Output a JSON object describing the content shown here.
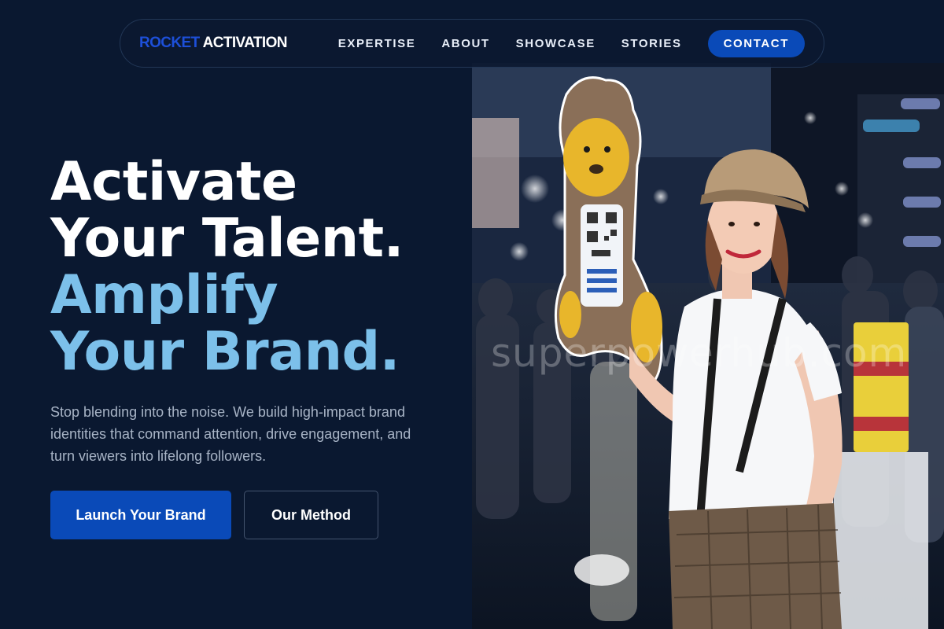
{
  "brand": {
    "part1": "ROCKET",
    "part2": "ACTIVATION"
  },
  "nav": {
    "links": [
      "EXPERTISE",
      "ABOUT",
      "SHOWCASE",
      "STORIES"
    ],
    "cta": "CONTACT"
  },
  "hero": {
    "line1": "Activate",
    "line2": "Your Talent.",
    "line3": "Amplify",
    "line4": "Your Brand.",
    "subtext": "Stop blending into the noise. We build high-impact brand identities that command attention, drive engagement, and turn viewers into lifelong followers.",
    "primary_button": "Launch Your Brand",
    "secondary_button": "Our Method"
  },
  "photo": {
    "watermark": "superpowerhub.com"
  },
  "colors": {
    "background": "#0a1830",
    "accent_blue": "#0a4ab8",
    "headline_light_blue": "#7cc0ea"
  }
}
